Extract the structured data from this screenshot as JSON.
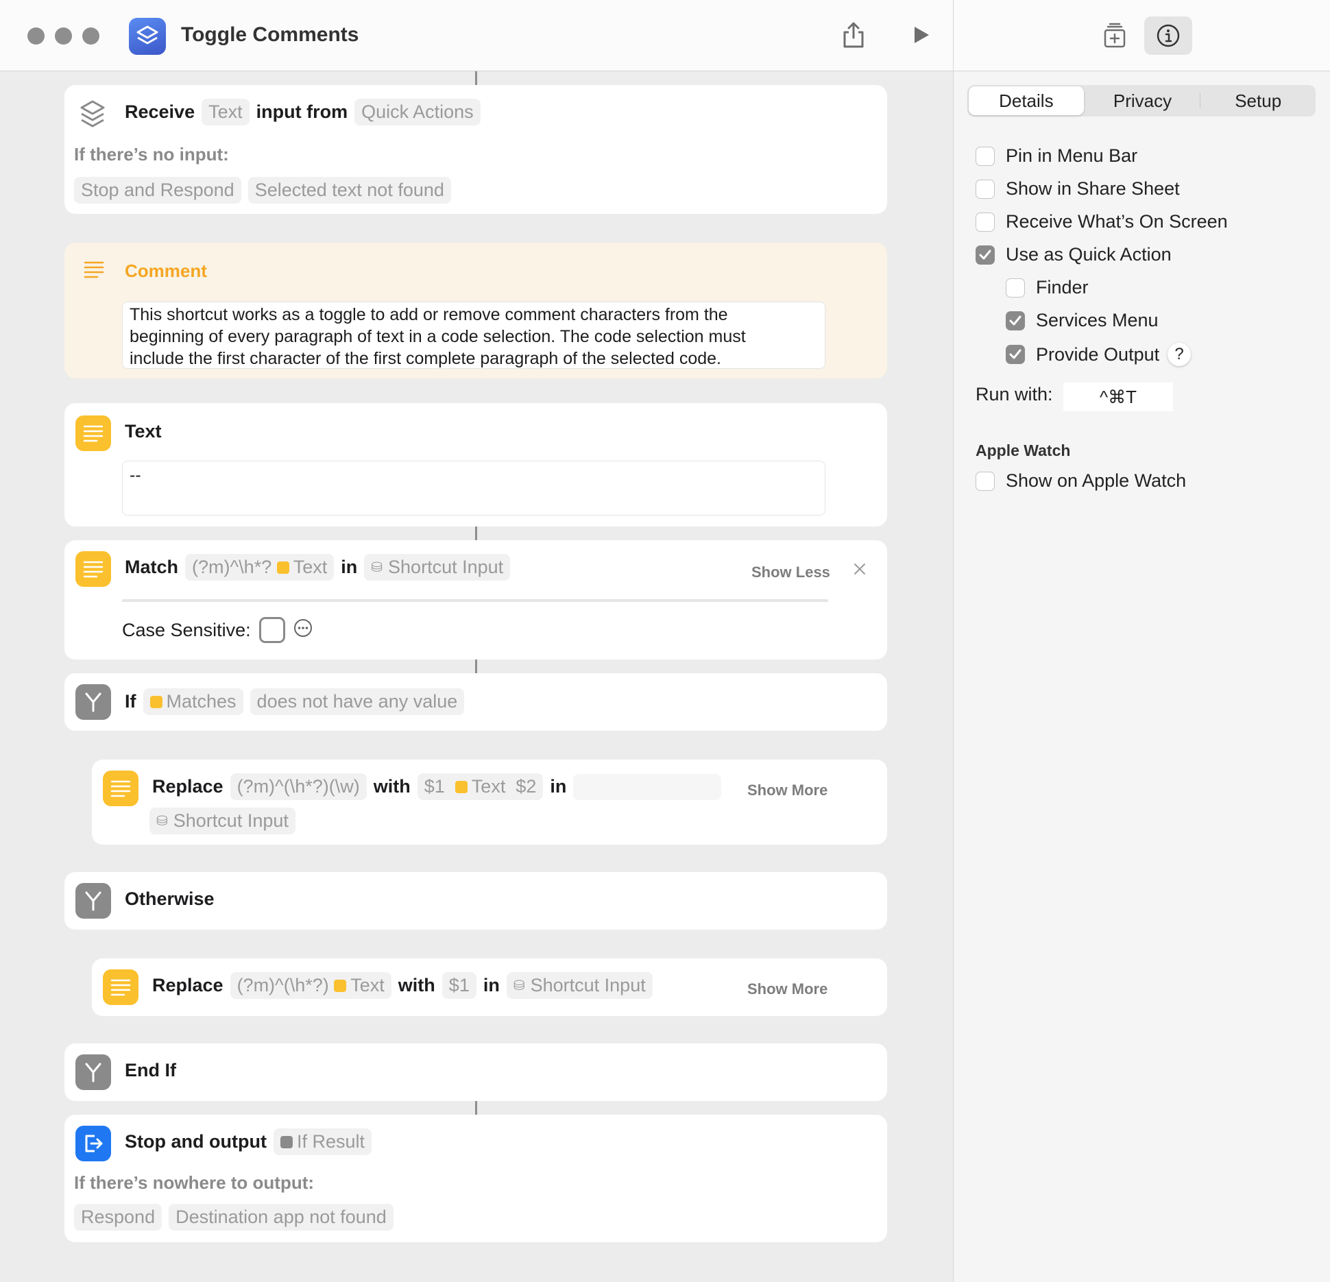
{
  "window": {
    "title": "Toggle Comments"
  },
  "inspector": {
    "tabs": [
      "Details",
      "Privacy",
      "Setup"
    ],
    "options": {
      "pin_menu_bar": "Pin in Menu Bar",
      "share_sheet": "Show in Share Sheet",
      "receive_screen": "Receive What’s On Screen",
      "quick_action": "Use as Quick Action",
      "finder": "Finder",
      "services_menu": "Services Menu",
      "provide_output": "Provide Output"
    },
    "help_glyph": "?",
    "run_with_label": "Run with:",
    "run_with_shortcut": "^⌘T",
    "apple_watch_heading": "Apple Watch",
    "show_on_watch": "Show on Apple Watch"
  },
  "actions": {
    "receive": {
      "kw_receive": "Receive",
      "tok_text": "Text",
      "kw_input_from": "input from",
      "tok_source": "Quick Actions",
      "no_input_label": "If there’s no input:",
      "tok_stop": "Stop and Respond",
      "tok_msg": "Selected text not found"
    },
    "comment": {
      "title": "Comment",
      "lines": [
        "This shortcut works as a toggle to add or remove comment characters from the",
        "beginning of every paragraph of text in a code selection. The code selection must",
        "include the first character of the first complete paragraph of the selected code."
      ]
    },
    "text": {
      "title": "Text",
      "value": "--"
    },
    "match": {
      "kw_match": "Match",
      "tok_pattern": "(?m)^\\h*?",
      "tok_text": "Text",
      "kw_in": "in",
      "tok_input": "Shortcut Input",
      "show_less": "Show Less",
      "case_label": "Case Sensitive:"
    },
    "if": {
      "kw_if": "If",
      "tok_matches": "Matches",
      "tok_condition": "does not have any value"
    },
    "replace1": {
      "kw_replace": "Replace",
      "tok_pattern": "(?m)^(\\h*?)(\\w)",
      "kw_with": "with",
      "tok_d1": "$1",
      "tok_text": "Text",
      "tok_d2": "$2",
      "kw_in": "in",
      "tok_input": "Shortcut Input",
      "show_more": "Show More"
    },
    "otherwise": {
      "title": "Otherwise"
    },
    "replace2": {
      "kw_replace": "Replace",
      "tok_pattern": "(?m)^(\\h*?)",
      "tok_text": "Text",
      "kw_with": "with",
      "tok_d1": "$1",
      "kw_in": "in",
      "tok_input": "Shortcut Input",
      "show_more": "Show More"
    },
    "endif": {
      "title": "End If"
    },
    "stop": {
      "kw_stop": "Stop and output",
      "tok_result": "If Result",
      "nowhere_label": "If there’s nowhere to output:",
      "tok_respond": "Respond",
      "tok_msg": "Destination app not found"
    }
  },
  "icons": {
    "share": "share-icon",
    "run": "play-icon",
    "library": "add-to-library-icon",
    "info": "info-icon",
    "close": "close-icon",
    "more": "ellipsis-circle-icon"
  },
  "colors": {
    "accent_yellow": "#fbc02d",
    "accent_blue": "#1f78f2",
    "comment_bg": "#faf3e6",
    "comment_title": "#f5a623",
    "scripting_gray": "#8a8a8a"
  }
}
